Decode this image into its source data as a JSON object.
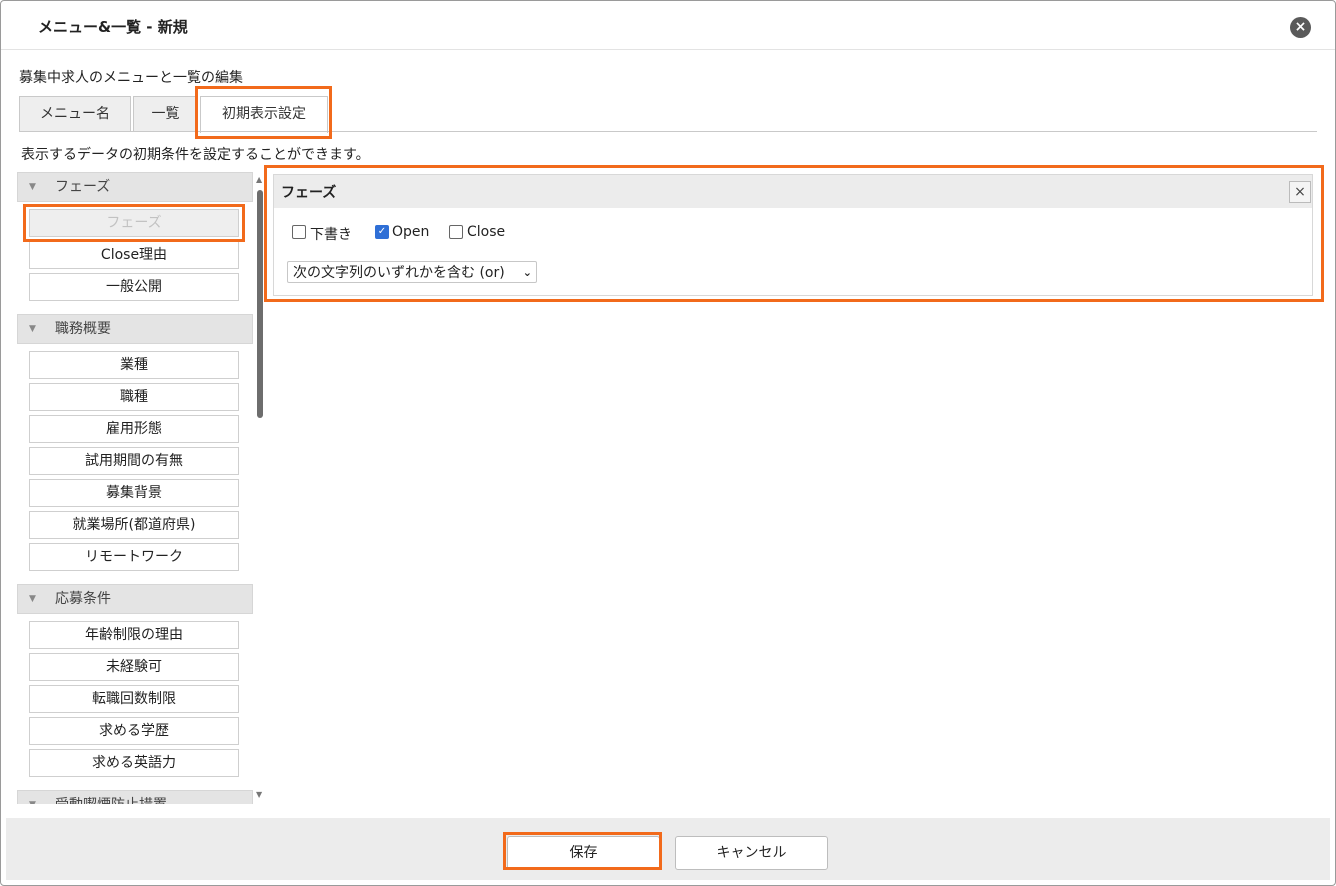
{
  "dialog": {
    "title": "メニュー&一覧 - 新規",
    "close_icon": "×"
  },
  "description": "募集中求人のメニューと一覧の編集",
  "tabs": [
    {
      "label": "メニュー名"
    },
    {
      "label": "一覧"
    },
    {
      "label": "初期表示設定"
    }
  ],
  "help_text": "表示するデータの初期条件を設定することができます。",
  "sidebar": {
    "groups": [
      {
        "label": "フェーズ",
        "items": [
          "フェーズ",
          "Close理由",
          "一般公開"
        ]
      },
      {
        "label": "職務概要",
        "items": [
          "業種",
          "職種",
          "雇用形態",
          "試用期間の有無",
          "募集背景",
          "就業場所(都道府県)",
          "リモートワーク"
        ]
      },
      {
        "label": "応募条件",
        "items": [
          "年齢制限の理由",
          "未経験可",
          "転職回数制限",
          "求める学歴",
          "求める英語力"
        ]
      },
      {
        "label": "受動喫煙防止措置",
        "items": []
      }
    ],
    "selected": "フェーズ"
  },
  "filter_panel": {
    "title": "フェーズ",
    "options": [
      {
        "label": "下書き",
        "checked": false
      },
      {
        "label": "Open",
        "checked": true
      },
      {
        "label": "Close",
        "checked": false
      }
    ],
    "select_value": "次の文字列のいずれかを含む (or)"
  },
  "footer": {
    "save_label": "保存",
    "cancel_label": "キャンセル"
  },
  "colors": {
    "highlight": "#f26a1b",
    "checkbox": "#2f6fd6"
  }
}
